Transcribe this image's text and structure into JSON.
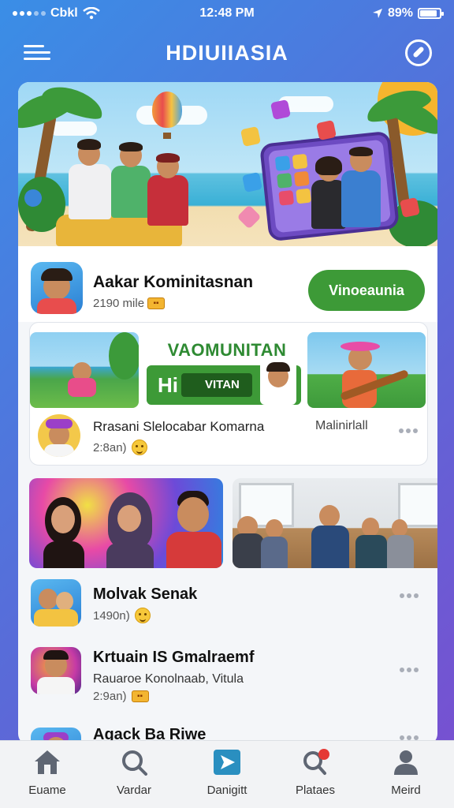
{
  "status_bar": {
    "carrier": "Cbkl",
    "time": "12:48 PM",
    "battery": "89%",
    "battery_level": 0.89
  },
  "header": {
    "title": "HDIUIIASIA"
  },
  "featured": {
    "title": "Aakar Kominitasnan",
    "subtitle": "2190 mile",
    "button_label": "Vinoeaunia"
  },
  "collage": {
    "mid_title": "VAOMUNITAN",
    "banner_hi": "Hi",
    "banner_chip": "VITAN",
    "title": "Rrasani Slelocabar Komarna",
    "right_label": "Malinirlall",
    "subtitle": "2:8an)"
  },
  "list": [
    {
      "title": "Molvak Senak",
      "subtitle": "1490n)"
    },
    {
      "title": "Krtuain IS Gmalraemf",
      "description": "Rauaroe Konolnaab, Vitula",
      "subtitle": "2:9an)"
    },
    {
      "title": "Agack Ba Riwe"
    }
  ],
  "bottom_nav": [
    {
      "label": "Euame",
      "icon": "home-icon"
    },
    {
      "label": "Vardar",
      "icon": "search-icon"
    },
    {
      "label": "Danigitt",
      "icon": "play-icon",
      "active": true
    },
    {
      "label": "Plataes",
      "icon": "notifications-icon",
      "badge": true
    },
    {
      "label": "Meird",
      "icon": "profile-icon"
    }
  ],
  "colors": {
    "accent_green": "#3d9a37",
    "active_nav": "#2a8fc0",
    "badge_red": "#e53935"
  }
}
